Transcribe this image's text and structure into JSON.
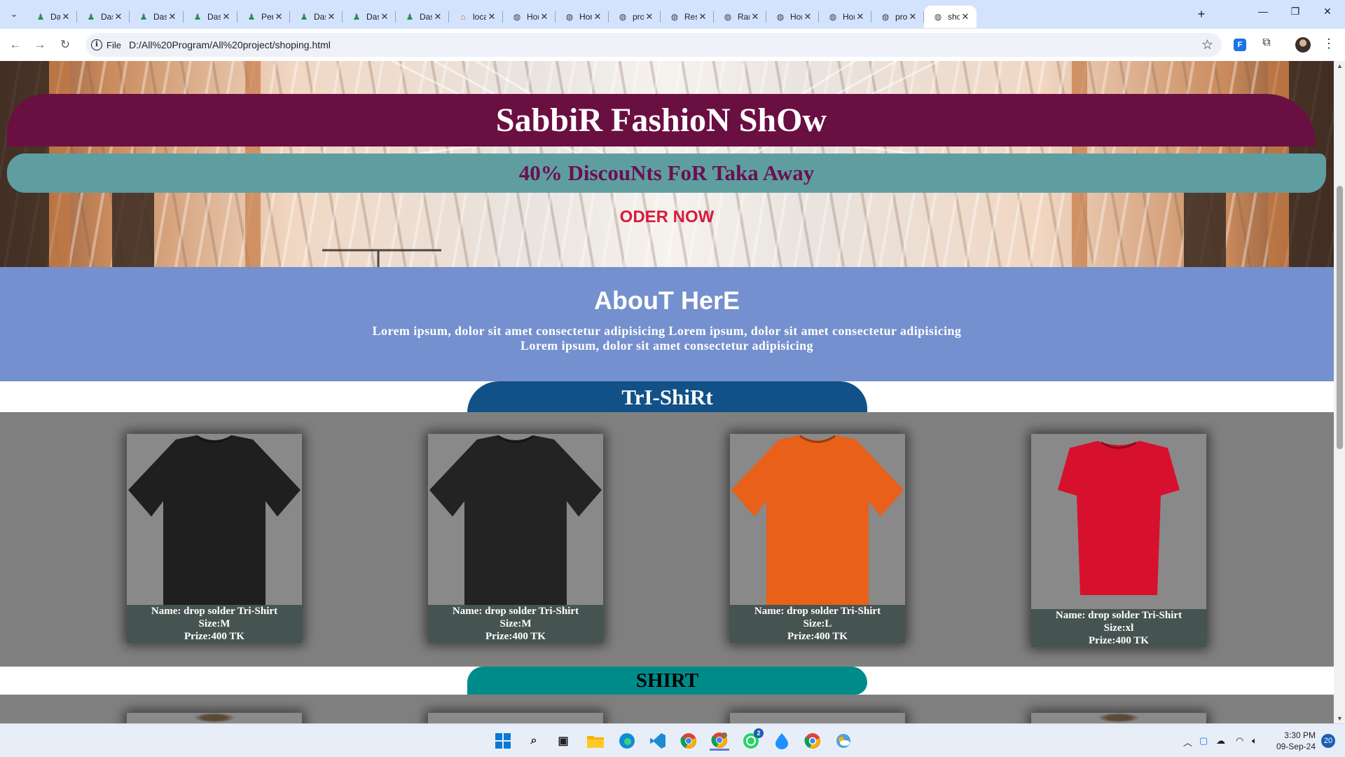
{
  "browser": {
    "tabs": [
      {
        "label": "Das",
        "icon": "person-icon"
      },
      {
        "label": "Das",
        "icon": "person-icon"
      },
      {
        "label": "Das",
        "icon": "person-icon"
      },
      {
        "label": "Das",
        "icon": "person-icon"
      },
      {
        "label": "Pers",
        "icon": "person-icon"
      },
      {
        "label": "Das",
        "icon": "person-icon"
      },
      {
        "label": "Das",
        "icon": "person-icon"
      },
      {
        "label": "Das",
        "icon": "person-icon"
      },
      {
        "label": "loca",
        "icon": "xampp-icon"
      },
      {
        "label": "Hor",
        "icon": "globe-icon"
      },
      {
        "label": "Hor",
        "icon": "globe-icon"
      },
      {
        "label": "proj",
        "icon": "globe-icon"
      },
      {
        "label": "Res",
        "icon": "globe-icon"
      },
      {
        "label": "Ran",
        "icon": "globe-icon"
      },
      {
        "label": "Hor",
        "icon": "globe-icon"
      },
      {
        "label": "Hor",
        "icon": "globe-icon"
      },
      {
        "label": "proj",
        "icon": "globe-icon"
      },
      {
        "label": "sho",
        "icon": "globe-icon",
        "active": true
      }
    ],
    "close_glyph": "✕",
    "new_tab_glyph": "+",
    "window": {
      "minimize": "—",
      "restore": "❐",
      "close": "✕"
    },
    "toolbar": {
      "back": "←",
      "forward": "→",
      "reload": "↻",
      "scheme_chip": "File",
      "url": "D:/All%20Program/All%20project/shoping.html",
      "bookmark": "☆",
      "menu": "⋮"
    }
  },
  "page": {
    "hero": {
      "title": "SabbiR FashioN ShOw",
      "discount": "40% DiscouNts FoR Taka Away",
      "order_button": "ODER NOW"
    },
    "about": {
      "heading": "AbouT HerE",
      "line1": "Lorem ipsum, dolor sit amet consectetur adipisicing Lorem ipsum, dolor sit amet consectetur adipisicing",
      "line2": "Lorem ipsum, dolor sit amet consectetur adipisicing"
    },
    "tshirt_section": {
      "heading": "TrI-ShiRt",
      "products": [
        {
          "name": "Name: drop solder Tri-Shirt",
          "size": "Size:M",
          "price": "Prize:400 TK",
          "color": "#1f1f1f"
        },
        {
          "name": "Name: drop solder Tri-Shirt",
          "size": "Size:M",
          "price": "Prize:400 TK",
          "color": "#232323"
        },
        {
          "name": "Name: drop solder Tri-Shirt",
          "size": "Size:L",
          "price": "Prize:400 TK",
          "color": "#e8601a"
        },
        {
          "name": "Name: drop solder Tri-Shirt",
          "size": "Size:xl",
          "price": "Prize:400 TK",
          "color": "#d7102e"
        }
      ]
    },
    "shirt_section": {
      "heading": "SHIRT"
    }
  },
  "colors": {
    "title_banner": "#6a0f42",
    "discount_banner": "#5f9ea0",
    "order_text": "#d81b3c",
    "about_bg": "#7590ce",
    "tshirt_header": "#115187",
    "shirt_header": "#008b8b",
    "grid_bg": "#808080",
    "caption_bg": "#465451"
  },
  "taskbar": {
    "apps": [
      "windows-start-icon",
      "search-icon",
      "task-view-icon",
      "file-explorer-icon",
      "edge-icon",
      "vscode-icon",
      "chrome-icon",
      "chrome-profile-icon",
      "whatsapp-icon",
      "app-drop-icon",
      "chrome-icon-2",
      "weather-icon"
    ],
    "whatsapp_badge": "2",
    "time": "3:30 PM",
    "date": "09-Sep-24",
    "notifications": "20"
  }
}
